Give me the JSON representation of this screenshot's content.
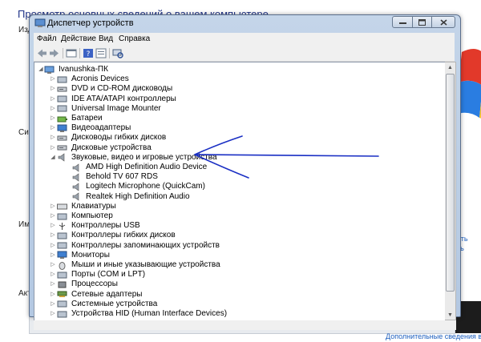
{
  "background": {
    "heading": "Просмотр основных сведений о вашем компьютере",
    "side_labels": [
      "Изд",
      "Сис",
      "Имя",
      "Акт"
    ],
    "right_link_fragments": [
      "ать",
      "ть"
    ],
    "bottom_link": "Дополнительные сведения в сети"
  },
  "window": {
    "title": "Диспетчер устройств",
    "menu": [
      "Файл",
      "Действие",
      "Вид",
      "Справка"
    ],
    "toolbar_icons": [
      "back-icon",
      "forward-icon",
      "show-hide-icon",
      "help-icon",
      "properties-icon",
      "scan-hardware-icon"
    ]
  },
  "tree": {
    "root": "Ivanushka-ПК",
    "items": [
      {
        "label": "Acronis Devices",
        "icon": "device-icon",
        "expanded": false
      },
      {
        "label": "DVD и CD-ROM дисководы",
        "icon": "dvd-icon",
        "expanded": false
      },
      {
        "label": "IDE ATA/ATAPI контроллеры",
        "icon": "ide-controller-icon",
        "expanded": false
      },
      {
        "label": "Universal Image Mounter",
        "icon": "mounter-icon",
        "expanded": false
      },
      {
        "label": "Батареи",
        "icon": "battery-icon",
        "expanded": false
      },
      {
        "label": "Видеоадаптеры",
        "icon": "display-adapter-icon",
        "expanded": false
      },
      {
        "label": "Дисководы гибких дисков",
        "icon": "floppy-drive-icon",
        "expanded": false
      },
      {
        "label": "Дисковые устройства",
        "icon": "disk-drive-icon",
        "expanded": false
      },
      {
        "label": "Звуковые, видео и игровые устройства",
        "icon": "speaker-icon",
        "expanded": true,
        "children": [
          "AMD High Definition Audio Device",
          "Behold TV 607 RDS",
          "Logitech Microphone (QuickCam)",
          "Realtek High Definition Audio"
        ]
      },
      {
        "label": "Клавиатуры",
        "icon": "keyboard-icon",
        "expanded": false
      },
      {
        "label": "Компьютер",
        "icon": "computer-icon",
        "expanded": false
      },
      {
        "label": "Контроллеры USB",
        "icon": "usb-icon",
        "expanded": false
      },
      {
        "label": "Контроллеры гибких дисков",
        "icon": "floppy-controller-icon",
        "expanded": false
      },
      {
        "label": "Контроллеры запоминающих устройств",
        "icon": "storage-controller-icon",
        "expanded": false
      },
      {
        "label": "Мониторы",
        "icon": "monitor-icon",
        "expanded": false
      },
      {
        "label": "Мыши и иные указывающие устройства",
        "icon": "mouse-icon",
        "expanded": false
      },
      {
        "label": "Порты (COM и LPT)",
        "icon": "port-icon",
        "expanded": false
      },
      {
        "label": "Процессоры",
        "icon": "processor-icon",
        "expanded": false
      },
      {
        "label": "Сетевые адаптеры",
        "icon": "network-adapter-icon",
        "expanded": false
      },
      {
        "label": "Системные устройства",
        "icon": "system-devices-icon",
        "expanded": false
      },
      {
        "label": "Устройства HID (Human Interface Devices)",
        "icon": "hid-icon",
        "expanded": false
      }
    ]
  },
  "annotation": {
    "color": "#1a2fc4"
  }
}
